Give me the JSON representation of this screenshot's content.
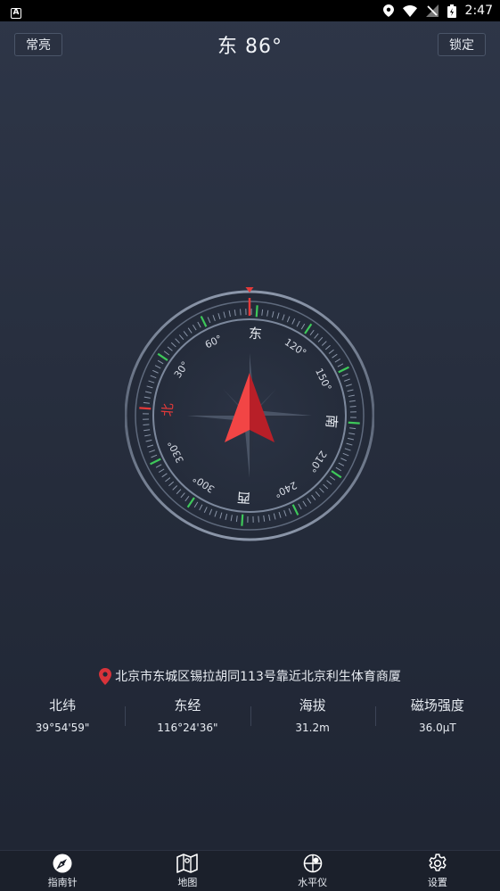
{
  "status_bar": {
    "time": "2:47",
    "notification_badge": "A"
  },
  "top_bar": {
    "left_button": "常亮",
    "heading": "东  86°",
    "right_button": "锁定"
  },
  "compass": {
    "heading_degrees": 86,
    "labels": {
      "north": "北",
      "east": "东",
      "south": "南",
      "west": "西",
      "d30": "30°",
      "d60": "60°",
      "d120": "120°",
      "d150": "150°",
      "d210": "210°",
      "d240": "240°",
      "d300": "300°",
      "d330": "330°"
    },
    "colors": {
      "accent_red": "#e43a3a",
      "tick_green": "#3ec85a",
      "ring": "#7c889c"
    }
  },
  "location": {
    "address": "北京市东城区锡拉胡同113号靠近北京利生体育商厦"
  },
  "stats": [
    {
      "label": "北纬",
      "value": "39°54'59\""
    },
    {
      "label": "东经",
      "value": "116°24'36\""
    },
    {
      "label": "海拔",
      "value": "31.2m"
    },
    {
      "label": "磁场强度",
      "value": "36.0μT"
    }
  ],
  "bottom_nav": [
    {
      "label": "指南针",
      "icon": "compass-icon"
    },
    {
      "label": "地图",
      "icon": "map-icon"
    },
    {
      "label": "水平仪",
      "icon": "level-icon"
    },
    {
      "label": "设置",
      "icon": "gear-icon"
    }
  ]
}
